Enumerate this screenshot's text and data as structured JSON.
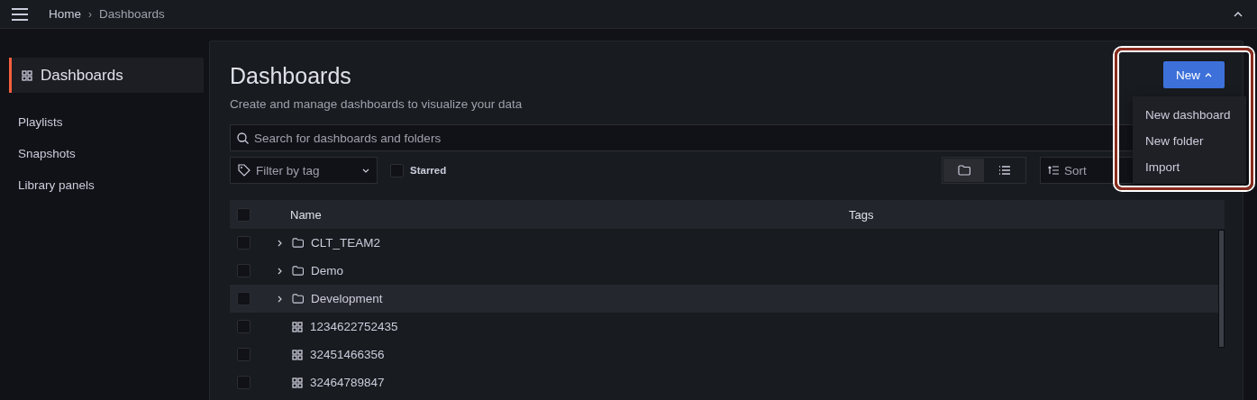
{
  "topbar": {
    "separator": "›",
    "breadcrumbs": [
      {
        "label": "Home",
        "current": false
      },
      {
        "label": "Dashboards",
        "current": true
      }
    ]
  },
  "sidebar": {
    "items": [
      {
        "label": "Dashboards",
        "selected": true,
        "kind": "section"
      },
      {
        "label": "Playlists",
        "selected": false,
        "kind": "link"
      },
      {
        "label": "Snapshots",
        "selected": false,
        "kind": "link"
      },
      {
        "label": "Library panels",
        "selected": false,
        "kind": "link"
      }
    ]
  },
  "page": {
    "title": "Dashboards",
    "subtitle": "Create and manage dashboards to visualize your data",
    "search": {
      "placeholder": "Search for dashboards and folders"
    },
    "tag_filter": {
      "placeholder": "Filter by tag"
    },
    "starred": {
      "label": "Starred",
      "checked": false
    },
    "view_toggle": [
      {
        "kind": "folder",
        "selected": true
      },
      {
        "kind": "list",
        "selected": false
      }
    ],
    "sort": {
      "placeholder": "Sort"
    },
    "new_button": {
      "label": "New",
      "expanded": true
    },
    "new_menu": [
      {
        "label": "New dashboard"
      },
      {
        "label": "New folder"
      },
      {
        "label": "Import"
      }
    ],
    "table": {
      "columns": [
        "Name",
        "Tags"
      ],
      "header_checked": false,
      "rows": [
        {
          "kind": "folder",
          "name": "CLT_TEAM2",
          "checked": false,
          "hovered": false
        },
        {
          "kind": "folder",
          "name": "Demo",
          "checked": false,
          "hovered": false
        },
        {
          "kind": "folder",
          "name": "Development",
          "checked": false,
          "hovered": true
        },
        {
          "kind": "dashboard",
          "name": "1234622752435",
          "checked": false,
          "hovered": false
        },
        {
          "kind": "dashboard",
          "name": "32451466356",
          "checked": false,
          "hovered": false
        },
        {
          "kind": "dashboard",
          "name": "32464789847",
          "checked": false,
          "hovered": false
        }
      ]
    }
  }
}
